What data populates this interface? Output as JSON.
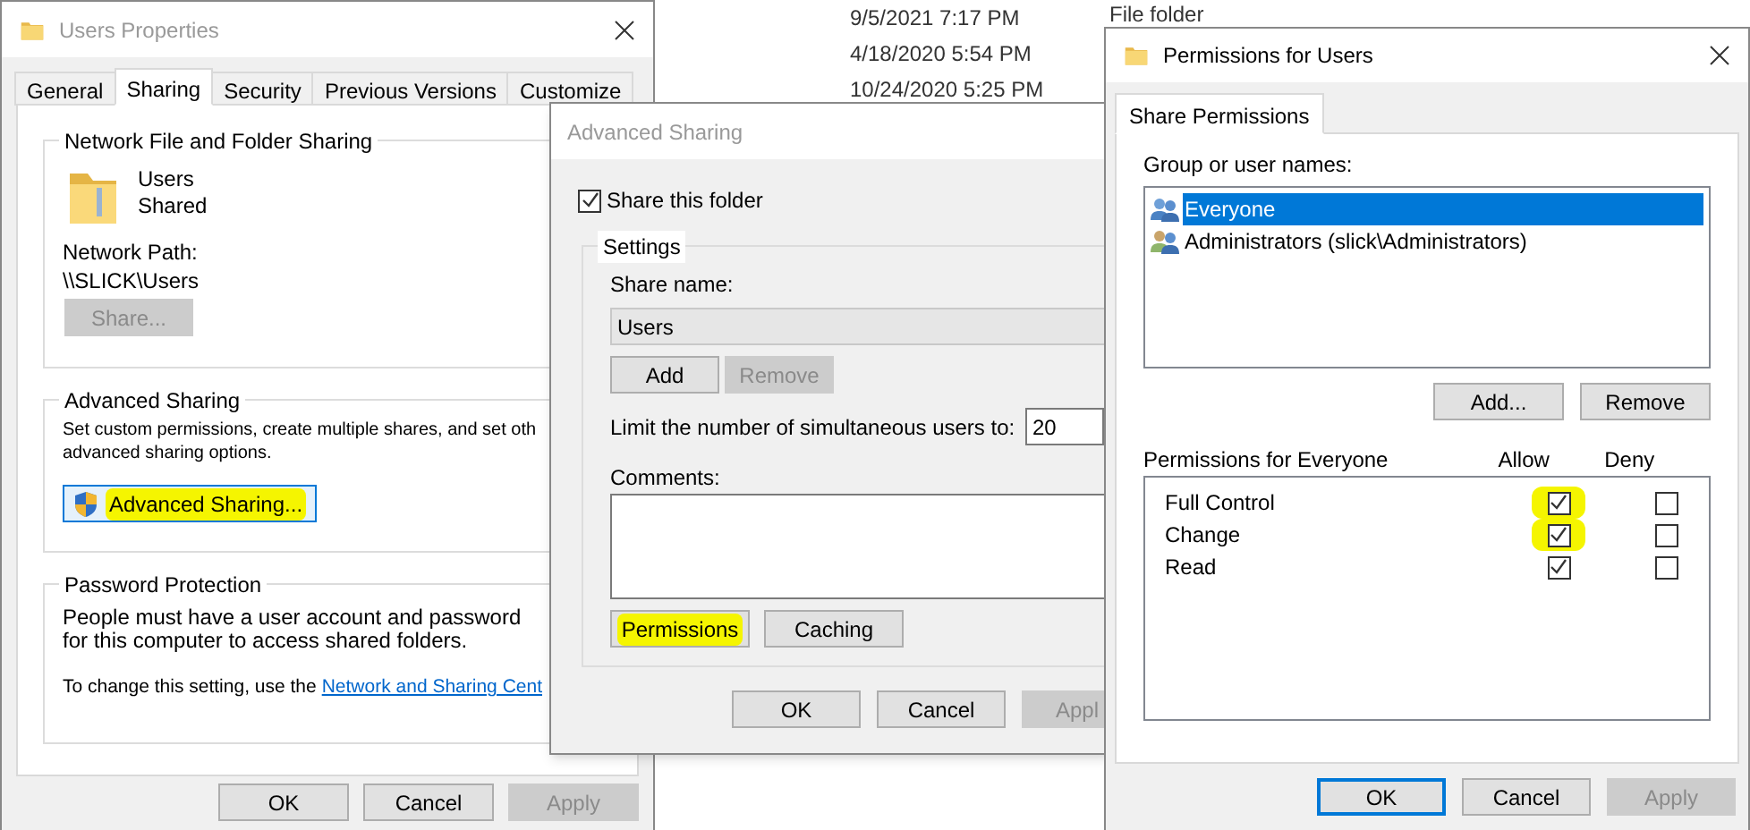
{
  "background": {
    "dates": [
      "9/5/2021 7:17 PM",
      "4/18/2020 5:54 PM",
      "10/24/2020 5:25 PM"
    ],
    "type_label": "File folder"
  },
  "properties": {
    "title": "Users Properties",
    "tabs": [
      {
        "label": "General",
        "selected": false
      },
      {
        "label": "Sharing",
        "selected": true
      },
      {
        "label": "Security",
        "selected": false
      },
      {
        "label": "Previous Versions",
        "selected": false
      },
      {
        "label": "Customize",
        "selected": false
      }
    ],
    "network_group": {
      "title": "Network File and Folder Sharing",
      "folder_name": "Users",
      "folder_status": "Shared",
      "path_label": "Network Path:",
      "path": "\\\\SLICK\\Users",
      "share_button": {
        "label": "Share...",
        "disabled": true
      }
    },
    "advanced_group": {
      "title": "Advanced Sharing",
      "description_lines": [
        "Set custom permissions, create multiple shares, and set oth",
        "advanced sharing options."
      ],
      "button": {
        "label": "Advanced Sharing...",
        "highlighted": true
      }
    },
    "password_group": {
      "title": "Password Protection",
      "description": "People must have a user account and password for this computer to access shared folders.",
      "change_text": "To change this setting, use the",
      "link": "Network and Sharing Cent"
    },
    "buttons": [
      {
        "label": "OK",
        "disabled": false
      },
      {
        "label": "Cancel",
        "disabled": false
      },
      {
        "label": "Apply",
        "disabled": true
      }
    ]
  },
  "advanced_sharing": {
    "title": "Advanced Sharing",
    "share_folder": {
      "label": "Share this folder",
      "checked": true
    },
    "settings_title": "Settings",
    "share_name_label": "Share name:",
    "share_name": "Users",
    "name_buttons": [
      {
        "label": "Add",
        "disabled": false
      },
      {
        "label": "Remove",
        "disabled": true
      }
    ],
    "limit_label": "Limit the number of simultaneous users to:",
    "limit_value": "20",
    "comments_label": "Comments:",
    "action_buttons": [
      {
        "label": "Permissions",
        "highlighted": true
      },
      {
        "label": "Caching",
        "highlighted": false
      }
    ],
    "buttons": [
      {
        "label": "OK",
        "disabled": false
      },
      {
        "label": "Cancel",
        "disabled": false
      },
      {
        "label": "Appl",
        "disabled": true
      }
    ]
  },
  "permissions": {
    "title": "Permissions for Users",
    "tab": {
      "label": "Share Permissions",
      "selected": true
    },
    "group_label": "Group or user names:",
    "users": [
      {
        "name": "Everyone",
        "selected": true
      },
      {
        "name": "Administrators (slick\\Administrators)",
        "selected": false
      }
    ],
    "user_buttons": [
      {
        "label": "Add...",
        "disabled": false
      },
      {
        "label": "Remove",
        "disabled": false
      }
    ],
    "permissions_label": "Permissions for Everyone",
    "columns": [
      "Allow",
      "Deny"
    ],
    "rows": [
      {
        "name": "Full Control",
        "allow": true,
        "deny": false,
        "highlighted": true
      },
      {
        "name": "Change",
        "allow": true,
        "deny": false,
        "highlighted": true
      },
      {
        "name": "Read",
        "allow": true,
        "deny": false,
        "highlighted": false
      }
    ],
    "buttons": [
      {
        "label": "OK",
        "default": true,
        "disabled": false
      },
      {
        "label": "Cancel",
        "default": false,
        "disabled": false
      },
      {
        "label": "Apply",
        "default": false,
        "disabled": true
      }
    ]
  }
}
